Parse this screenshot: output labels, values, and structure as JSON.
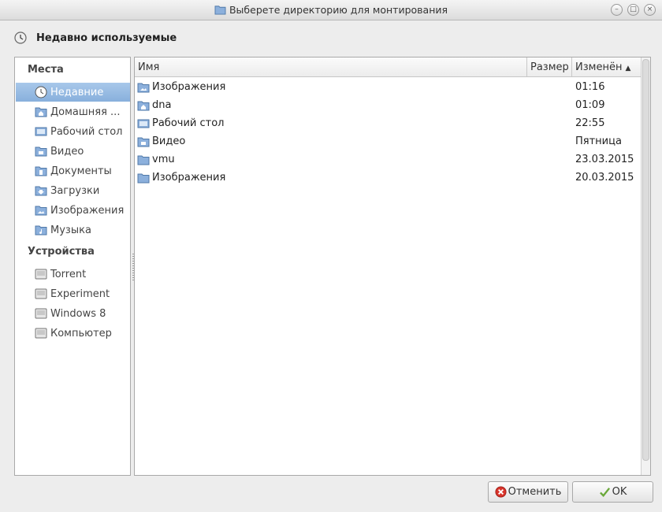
{
  "window": {
    "title": "Выберете директорию для монтирования"
  },
  "location": {
    "label": "Недавно используемые"
  },
  "sidebar": {
    "places_header": "Места",
    "places": [
      {
        "label": "Недавние",
        "icon": "recent-clock-icon",
        "selected": true
      },
      {
        "label": "Домашняя ...",
        "icon": "home-folder-icon"
      },
      {
        "label": "Рабочий стол",
        "icon": "desktop-icon"
      },
      {
        "label": "Видео",
        "icon": "video-folder-icon"
      },
      {
        "label": "Документы",
        "icon": "documents-folder-icon"
      },
      {
        "label": "Загрузки",
        "icon": "downloads-folder-icon"
      },
      {
        "label": "Изображения",
        "icon": "pictures-folder-icon"
      },
      {
        "label": "Музыка",
        "icon": "music-folder-icon"
      }
    ],
    "devices_header": "Устройства",
    "devices": [
      {
        "label": "Torrent",
        "icon": "drive-icon"
      },
      {
        "label": "Experiment",
        "icon": "drive-icon"
      },
      {
        "label": "Windows 8",
        "icon": "drive-icon"
      },
      {
        "label": "Компьютер",
        "icon": "computer-drive-icon"
      }
    ]
  },
  "file_list": {
    "columns": {
      "name": "Имя",
      "size": "Размер",
      "modified": "Изменён"
    },
    "rows": [
      {
        "name": "Изображения",
        "size": "",
        "modified": "01:16",
        "icon": "pictures-folder-icon"
      },
      {
        "name": "dna",
        "size": "",
        "modified": "01:09",
        "icon": "home-folder-icon"
      },
      {
        "name": "Рабочий стол",
        "size": "",
        "modified": "22:55",
        "icon": "desktop-icon"
      },
      {
        "name": "Видео",
        "size": "",
        "modified": "Пятница",
        "icon": "video-folder-icon"
      },
      {
        "name": "vmu",
        "size": "",
        "modified": "23.03.2015",
        "icon": "folder-icon"
      },
      {
        "name": "Изображения",
        "size": "",
        "modified": "20.03.2015",
        "icon": "folder-icon"
      }
    ]
  },
  "buttons": {
    "cancel": "Отменить",
    "ok": "OK"
  },
  "colors": {
    "selection": "#88b0dc",
    "folder": "#7ba7d6"
  }
}
